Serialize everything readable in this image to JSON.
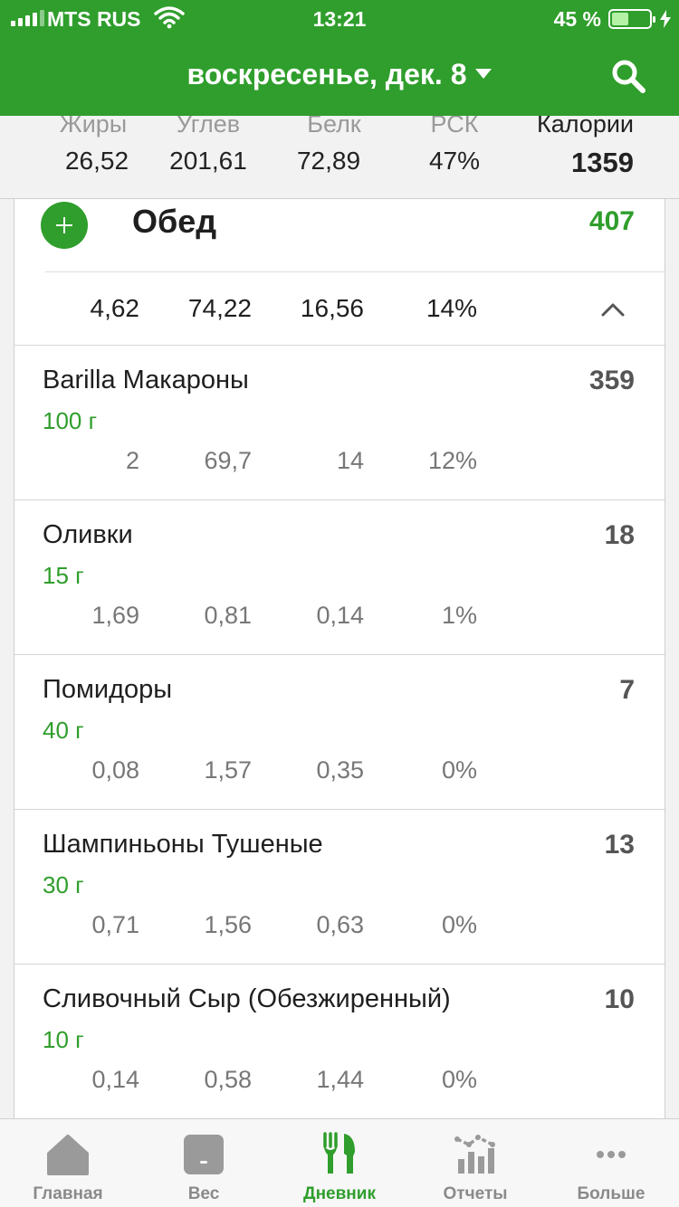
{
  "status_bar": {
    "carrier": "MTS RUS",
    "time": "13:21",
    "battery_text": "45 %",
    "battery_level": 0.45
  },
  "header": {
    "date": "воскресенье, дек. 8"
  },
  "summary": {
    "fat_label": "Жиры",
    "carbs_label": "Углев",
    "protein_label": "Белк",
    "rsk_label": "РСК",
    "calories_label": "Калории",
    "fat": "26,52",
    "carbs": "201,61",
    "protein": "72,89",
    "rsk": "47%",
    "calories": "1359"
  },
  "meal": {
    "title": "Обед",
    "calories": "407",
    "fat": "4,62",
    "carbs": "74,22",
    "protein": "16,56",
    "rsk": "14%"
  },
  "items": [
    {
      "name": "Barilla Макароны",
      "qty": "100 г",
      "calories": "359",
      "fat": "2",
      "carbs": "69,7",
      "protein": "14",
      "rsk": "12%"
    },
    {
      "name": "Оливки",
      "qty": "15 г",
      "calories": "18",
      "fat": "1,69",
      "carbs": "0,81",
      "protein": "0,14",
      "rsk": "1%"
    },
    {
      "name": "Помидоры",
      "qty": "40 г",
      "calories": "7",
      "fat": "0,08",
      "carbs": "1,57",
      "protein": "0,35",
      "rsk": "0%"
    },
    {
      "name": "Шампиньоны Тушеные",
      "qty": "30 г",
      "calories": "13",
      "fat": "0,71",
      "carbs": "1,56",
      "protein": "0,63",
      "rsk": "0%"
    },
    {
      "name": "Сливочный Сыр (Обезжиренный)",
      "qty": "10 г",
      "calories": "10",
      "fat": "0,14",
      "carbs": "0,58",
      "protein": "1,44",
      "rsk": "0%"
    }
  ],
  "tabs": [
    {
      "label": "Главная",
      "icon": "home-icon",
      "active": false
    },
    {
      "label": "Вес",
      "icon": "scale-icon",
      "active": false
    },
    {
      "label": "Дневник",
      "icon": "fork-knife-icon",
      "active": true
    },
    {
      "label": "Отчеты",
      "icon": "reports-icon",
      "active": false
    },
    {
      "label": "Больше",
      "icon": "more-icon",
      "active": false
    }
  ],
  "colors": {
    "brand_green": "#2f9e2c",
    "inactive_gray": "#8a8a8a",
    "background": "#f2f2f2"
  }
}
